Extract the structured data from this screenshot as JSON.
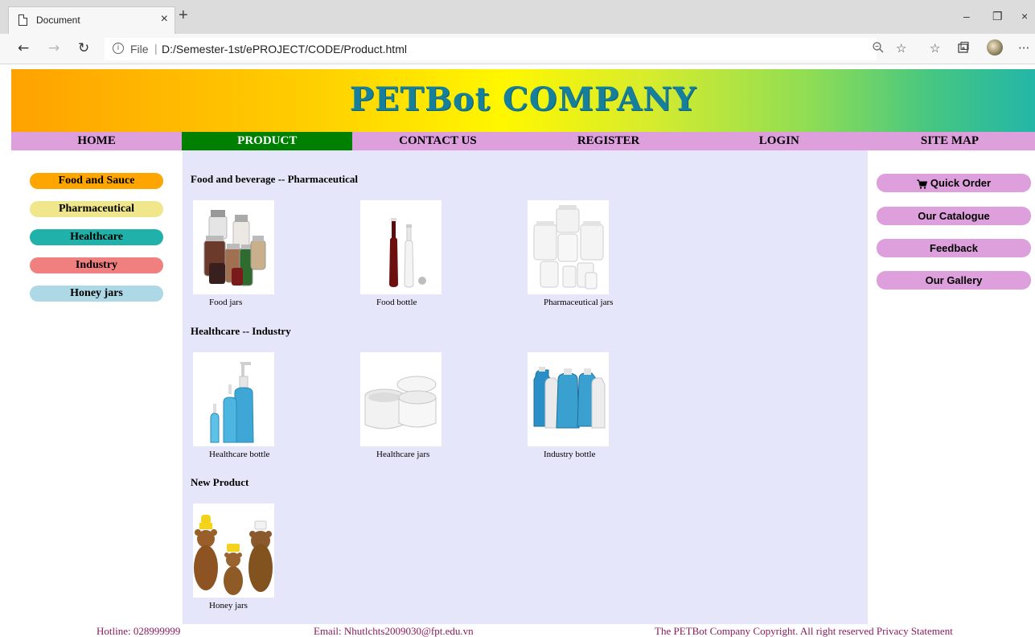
{
  "browser": {
    "tab_title": "Document",
    "tab_close": "×",
    "new_tab": "+",
    "url_scheme": "File",
    "url": "D:/Semester-1st/ePROJECT/CODE/Product.html",
    "window_controls": {
      "minimize": "–",
      "restore": "❐",
      "close": "×"
    },
    "more": "···"
  },
  "banner": {
    "title": "PETBot COMPANY"
  },
  "nav": [
    {
      "label": "HOME"
    },
    {
      "label": "PRODUCT"
    },
    {
      "label": "CONTACT US"
    },
    {
      "label": "REGISTER"
    },
    {
      "label": "LOGIN"
    },
    {
      "label": "SITE MAP"
    }
  ],
  "sidebar": [
    {
      "label": "Food and Sauce",
      "color": "#ffa500"
    },
    {
      "label": "Pharmaceutical",
      "color": "#f0e68c"
    },
    {
      "label": "Healthcare",
      "color": "#20b2aa"
    },
    {
      "label": "Industry",
      "color": "#f08080"
    },
    {
      "label": "Honey jars",
      "color": "#add8e6"
    }
  ],
  "content": {
    "sections": [
      {
        "title": "Food and beverage -- Pharmaceutical",
        "products": [
          {
            "caption": "Food jars"
          },
          {
            "caption": "Food bottle"
          },
          {
            "caption": "Pharmaceutical jars"
          }
        ]
      },
      {
        "title": "Healthcare -- Industry",
        "products": [
          {
            "caption": "Healthcare bottle"
          },
          {
            "caption": "Healthcare jars"
          },
          {
            "caption": "Industry bottle"
          }
        ]
      },
      {
        "title": "New Product",
        "products": [
          {
            "caption": "Honey jars"
          }
        ]
      }
    ]
  },
  "rightbar": [
    {
      "label": "Quick Order",
      "icon": "cart-icon"
    },
    {
      "label": "Our Catalogue"
    },
    {
      "label": "Feedback"
    },
    {
      "label": "Our Gallery"
    }
  ],
  "footer": {
    "hotline": "Hotline: 028999999",
    "email": "Email: Nhutlchts2009030@fpt.edu.vn",
    "copyright": "The PETBot Company Copyright. All right reserved Privacy Statement"
  },
  "colors": {
    "nav_bg": "#dda0dd",
    "nav_active": "#008000",
    "content_bg": "#e6e6fa",
    "title": "#167f9c",
    "footer_text": "#8b1a5b"
  }
}
